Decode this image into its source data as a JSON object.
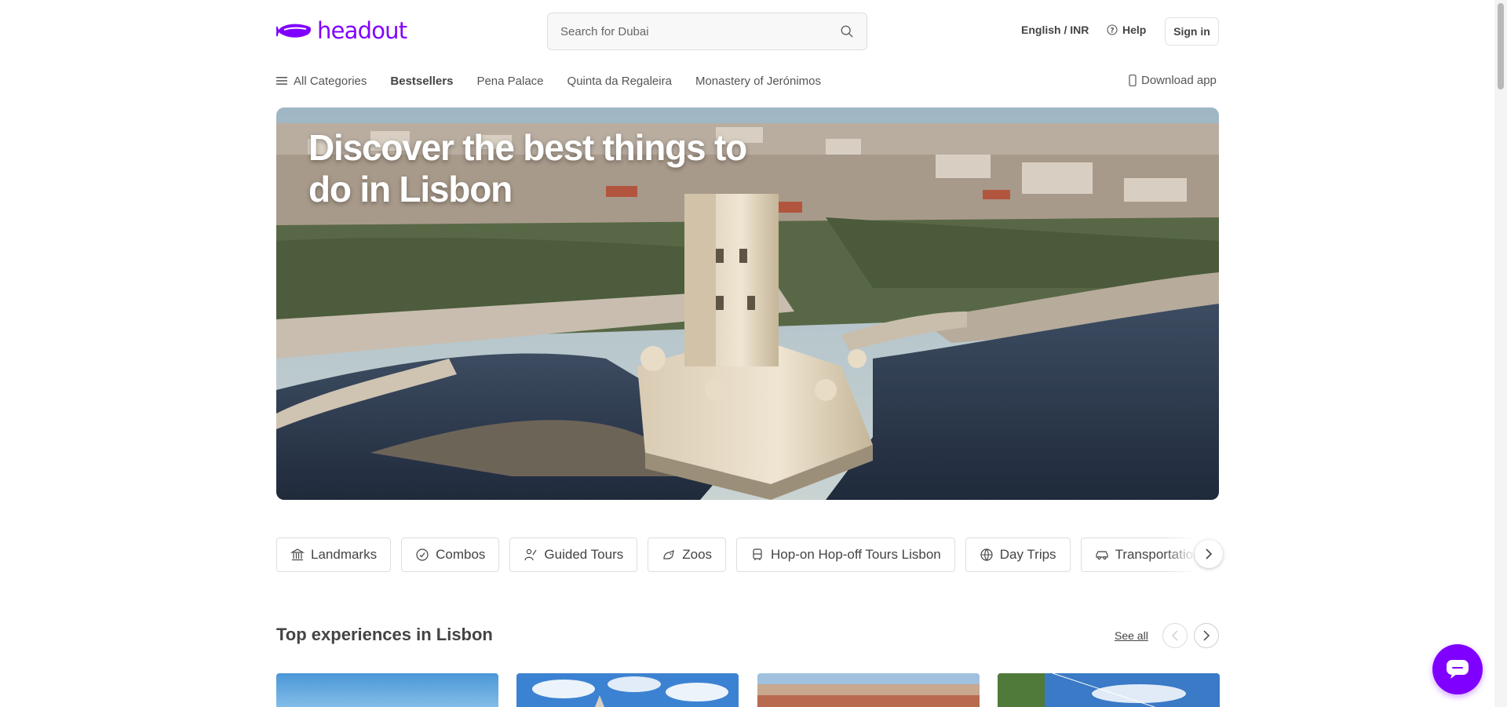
{
  "brand": {
    "name": "headout",
    "color": "#8000ff"
  },
  "header": {
    "search_placeholder": "Search for Dubai",
    "language_currency": "English / INR",
    "help": "Help",
    "sign_in": "Sign in"
  },
  "nav": {
    "items": [
      {
        "label": "All Categories",
        "icon": "menu-icon"
      },
      {
        "label": "Bestsellers"
      },
      {
        "label": "Pena Palace"
      },
      {
        "label": "Quinta da Regaleira"
      },
      {
        "label": "Monastery of Jerónimos"
      }
    ],
    "download_app": "Download app"
  },
  "hero": {
    "title": "Discover the best things to do in Lisbon"
  },
  "categories": [
    {
      "label": "Landmarks",
      "icon": "landmark-icon"
    },
    {
      "label": "Combos",
      "icon": "combo-icon"
    },
    {
      "label": "Guided Tours",
      "icon": "guide-icon"
    },
    {
      "label": "Zoos",
      "icon": "zoo-icon"
    },
    {
      "label": "Hop-on Hop-off Tours Lisbon",
      "icon": "bus-icon"
    },
    {
      "label": "Day Trips",
      "icon": "globe-icon"
    },
    {
      "label": "Transportation",
      "icon": "car-icon"
    }
  ],
  "section": {
    "title": "Top experiences in Lisbon",
    "see_all": "See all"
  }
}
